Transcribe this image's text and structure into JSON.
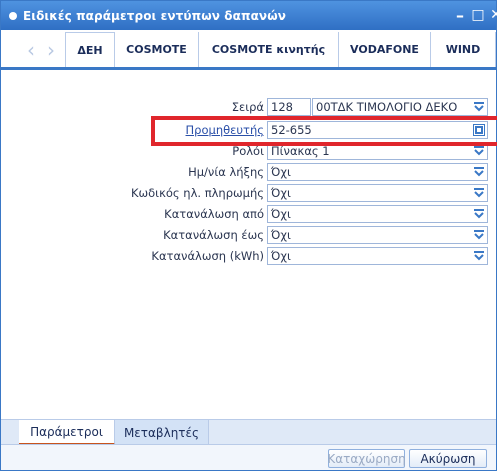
{
  "window": {
    "title": "Ειδικές παράμετροι εντύπων δαπανών",
    "minimize": "–",
    "maximize": "□",
    "close": "✕"
  },
  "tabs": [
    {
      "label": "ΔΕΗ",
      "active": true
    },
    {
      "label": "COSMOTE",
      "active": false
    },
    {
      "label": "COSMOTE κινητής",
      "active": false
    },
    {
      "label": "VODAFONE",
      "active": false
    },
    {
      "label": "WIND",
      "active": false
    }
  ],
  "form": {
    "series": {
      "label": "Σειρά",
      "code": "128",
      "description": "00ΤΔΚ ΤΙΜΟΛΟΓΙΟ ΔΕΚΟ"
    },
    "supplier": {
      "label": "Προμηθευτής",
      "value": "52-655"
    },
    "role": {
      "label": "Ρολόι",
      "value": "Πίνακας 1"
    },
    "due_date": {
      "label": "Ημ/νία λήξης",
      "value": "Όχι"
    },
    "payment_code": {
      "label": "Κωδικός ηλ. πληρωμής",
      "value": "Όχι"
    },
    "consumption_from": {
      "label": "Κατανάλωση από",
      "value": "Όχι"
    },
    "consumption_to": {
      "label": "Κατανάλωση έως",
      "value": "Όχι"
    },
    "consumption_kwh": {
      "label": "Κατανάλωση (kWh)",
      "value": "Όχι"
    }
  },
  "bottom_tabs": [
    {
      "label": "Παράμετροι",
      "active": true
    },
    {
      "label": "Μεταβλητές",
      "active": false
    }
  ],
  "footer": {
    "save_label": "Καταχώρηση",
    "cancel_label": "Ακύρωση"
  },
  "colors": {
    "accent": "#3a78c6",
    "highlight": "#e0262c"
  }
}
